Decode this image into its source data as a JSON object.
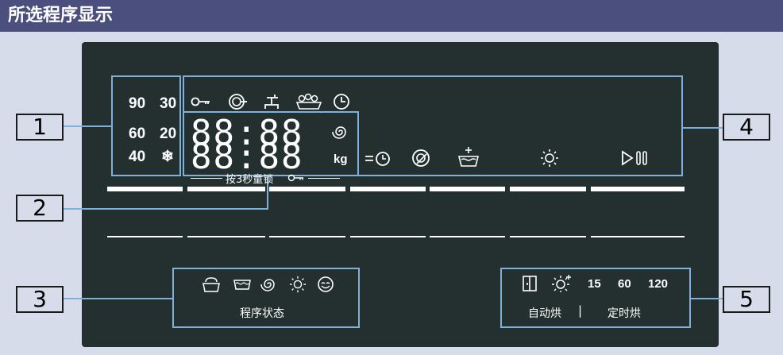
{
  "header": {
    "title": "所选程序显示"
  },
  "callouts": [
    "1",
    "2",
    "3",
    "4",
    "5"
  ],
  "temperatures": {
    "t90": "90",
    "t30": "30",
    "t60": "60",
    "t20": "20",
    "t40": "40",
    "snowflake": "❄"
  },
  "display": {
    "line1": "88:88",
    "line2": "88:88",
    "unit": "kg",
    "child_lock_hint": "按3秒童锁"
  },
  "icons_top": [
    "key-icon",
    "stain-icon",
    "tap-icon",
    "prewash-icon",
    "clock-icon"
  ],
  "icons_middle": [
    "spin-icon",
    "delay-end-icon",
    "fabric-softener-icon",
    "wash-basin-icon",
    "dry-sun-icon",
    "start-pause-icon"
  ],
  "status": {
    "label": "程序状态",
    "icons": [
      "wash-icon",
      "rinse-icon",
      "spin-icon",
      "dry-icon",
      "finish-icon"
    ]
  },
  "drying": {
    "auto_label": "自动烘",
    "timer_label": "定时烘",
    "separator": "|",
    "times": [
      "15",
      "60",
      "120"
    ],
    "icons": [
      "door-icon",
      "sun-plus-icon"
    ]
  },
  "colors": {
    "panel": "#23302f",
    "accent": "#7fb0d8",
    "title_bar": "#4a4f7d",
    "page": "#d7dcea"
  }
}
